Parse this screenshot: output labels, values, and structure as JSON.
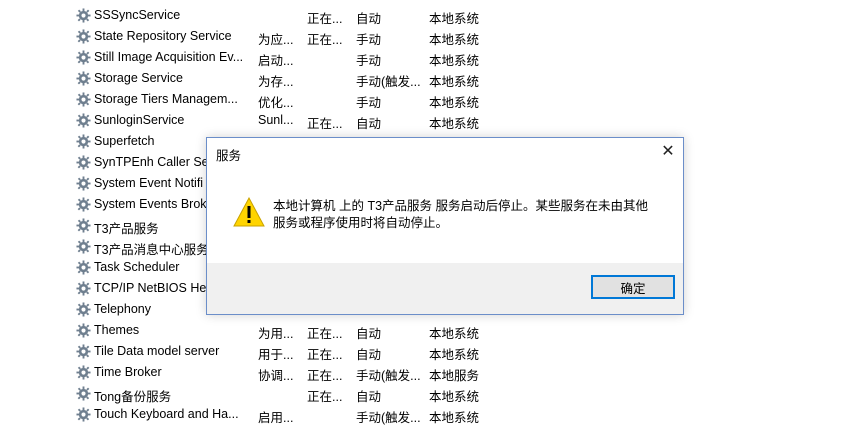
{
  "services": [
    {
      "name": "SSSyncService",
      "description": "",
      "status": "正在...",
      "startup": "自动",
      "logon": "本地系统"
    },
    {
      "name": "State Repository Service",
      "description": "为应...",
      "status": "正在...",
      "startup": "手动",
      "logon": "本地系统"
    },
    {
      "name": "Still Image Acquisition Ev...",
      "description": "启动...",
      "status": "",
      "startup": "手动",
      "logon": "本地系统"
    },
    {
      "name": "Storage Service",
      "description": "为存...",
      "status": "",
      "startup": "手动(触发...",
      "logon": "本地系统"
    },
    {
      "name": "Storage Tiers Managem...",
      "description": "优化...",
      "status": "",
      "startup": "手动",
      "logon": "本地系统"
    },
    {
      "name": "SunloginService",
      "description": "Sunl...",
      "status": "正在...",
      "startup": "自动",
      "logon": "本地系统"
    },
    {
      "name": "Superfetch",
      "description": "",
      "status": "",
      "startup": "",
      "logon": ""
    },
    {
      "name": "SynTPEnh Caller Ser",
      "description": "",
      "status": "",
      "startup": "",
      "logon": ""
    },
    {
      "name": "System Event Notifi",
      "description": "",
      "status": "",
      "startup": "",
      "logon": ""
    },
    {
      "name": "System Events Brok",
      "description": "",
      "status": "",
      "startup": "",
      "logon": ""
    },
    {
      "name": "T3产品服务",
      "description": "",
      "status": "",
      "startup": "",
      "logon": ""
    },
    {
      "name": "T3产品消息中心服务",
      "description": "",
      "status": "",
      "startup": "",
      "logon": ""
    },
    {
      "name": "Task Scheduler",
      "description": "",
      "status": "",
      "startup": "",
      "logon": ""
    },
    {
      "name": "TCP/IP NetBIOS He",
      "description": "",
      "status": "",
      "startup": "",
      "logon": ""
    },
    {
      "name": "Telephony",
      "description": "",
      "status": "",
      "startup": "",
      "logon": ""
    },
    {
      "name": "Themes",
      "description": "为用...",
      "status": "正在...",
      "startup": "自动",
      "logon": "本地系统"
    },
    {
      "name": "Tile Data model server",
      "description": "用于...",
      "status": "正在...",
      "startup": "自动",
      "logon": "本地系统"
    },
    {
      "name": "Time Broker",
      "description": "协调...",
      "status": "正在...",
      "startup": "手动(触发...",
      "logon": "本地服务"
    },
    {
      "name": "Tong备份服务",
      "description": "",
      "status": "正在...",
      "startup": "自动",
      "logon": "本地系统"
    },
    {
      "name": "Touch Keyboard and Ha...",
      "description": "启用...",
      "status": "",
      "startup": "手动(触发...",
      "logon": "本地系统"
    }
  ],
  "dialog": {
    "title": "服务",
    "close_glyph": "✕",
    "message": "本地计算机 上的 T3产品服务 服务启动后停止。某些服务在未由其他服务或程序使用时将自动停止。",
    "ok_label": "确定",
    "icon": "warning-icon"
  },
  "colors": {
    "gear": "#6f7f8f",
    "warning_fill": "#ffd400",
    "dialog_border": "#6b8ec9",
    "ok_border": "#0078d7"
  }
}
